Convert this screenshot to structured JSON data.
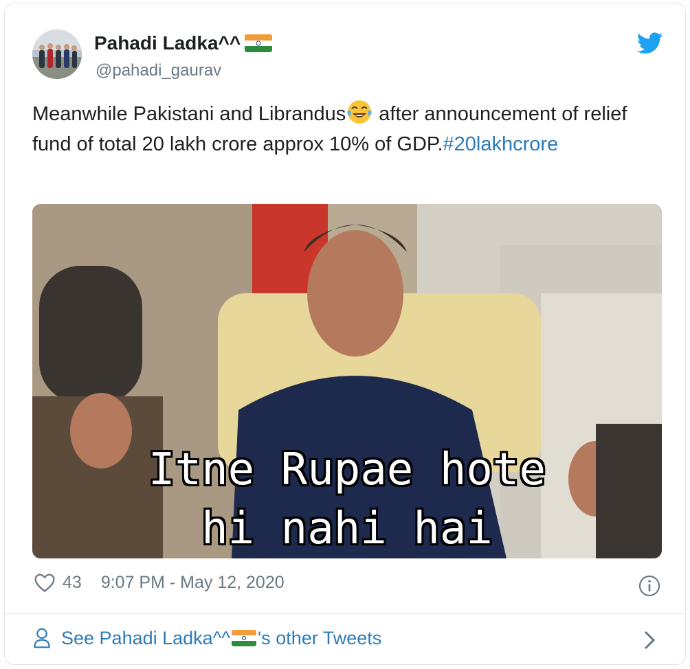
{
  "author": {
    "name": "Pahadi Ladka^^",
    "handle": "@pahadi_gaurav"
  },
  "tweet": {
    "text_part1": "Meanwhile Pakistani and Librandus",
    "text_part2": " after announcement of relief fund of total 20 lakh crore approx 10% of GDP.",
    "hashtag": "#20lakhcrore",
    "emoji_icon": "face-with-tears-of-joy-icon"
  },
  "media": {
    "caption_line1": "Itne Rupae hote",
    "caption_line2": "hi nahi hai"
  },
  "meta": {
    "likes": "43",
    "timestamp": "9:07 PM - May 12, 2020"
  },
  "footer": {
    "link_prefix": "See Pahadi Ladka^^",
    "link_suffix": "'s other Tweets"
  },
  "colors": {
    "twitter_blue": "#1da1f2",
    "link_blue": "#2b7bb9",
    "muted_gray": "#697882"
  }
}
